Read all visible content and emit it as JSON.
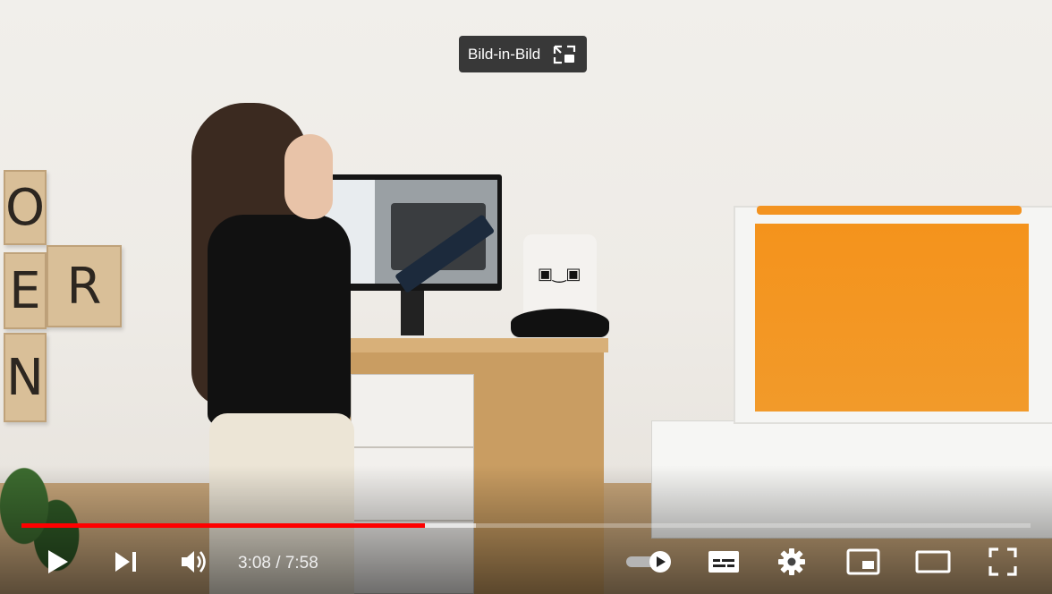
{
  "player": {
    "tooltip": {
      "label": "Bild-in-Bild",
      "icon": "pip-exit-icon"
    },
    "time": {
      "current": "3:08",
      "separator": " / ",
      "duration": "7:58"
    },
    "progress": {
      "played_fraction": 0.4,
      "buffered_fraction": 0.45
    },
    "colors": {
      "played": "#ff0000",
      "accent_orange": "#f4931c"
    },
    "controls": {
      "play": "play-icon",
      "next": "next-icon",
      "volume": "volume-icon",
      "autoplay": "autoplay-toggle-icon",
      "subtitles": "subtitles-icon",
      "settings": "gear-icon",
      "miniplayer": "miniplayer-icon",
      "theater": "theater-mode-icon",
      "fullscreen": "fullscreen-icon"
    },
    "scene": {
      "wall_tile_letters": [
        "O",
        "E",
        "R",
        "N"
      ]
    }
  }
}
